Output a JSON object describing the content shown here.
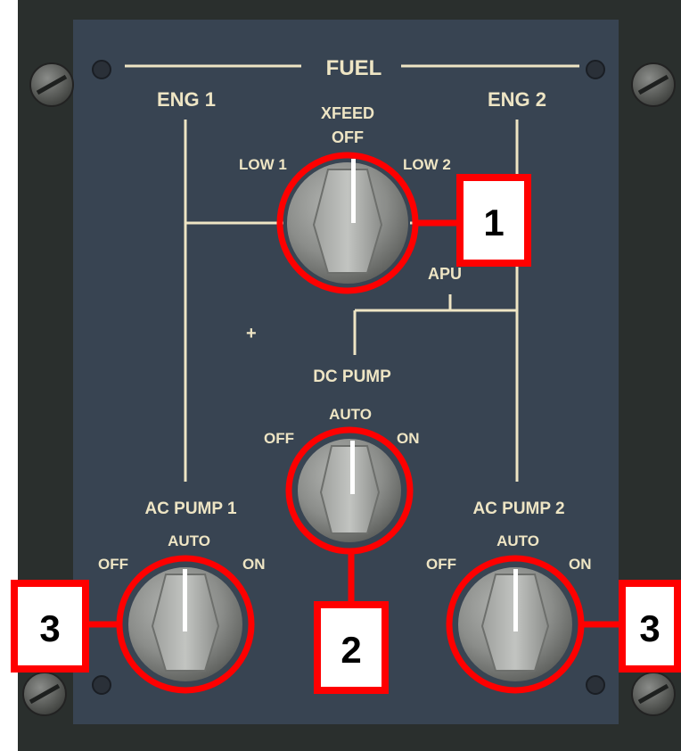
{
  "panel": {
    "title": "FUEL",
    "eng1": "ENG 1",
    "eng2": "ENG 2",
    "apu": "APU",
    "marker": "+"
  },
  "xfeed": {
    "label": "XFEED",
    "pos_top": "OFF",
    "pos_left": "LOW 1",
    "pos_right": "LOW 2",
    "selected": "OFF"
  },
  "dc_pump": {
    "label": "DC PUMP",
    "pos_left": "OFF",
    "pos_top": "AUTO",
    "pos_right": "ON",
    "selected": "AUTO"
  },
  "ac_pump_1": {
    "label": "AC PUMP 1",
    "pos_left": "OFF",
    "pos_top": "AUTO",
    "pos_right": "ON",
    "selected": "AUTO"
  },
  "ac_pump_2": {
    "label": "AC PUMP 2",
    "pos_left": "OFF",
    "pos_top": "AUTO",
    "pos_right": "ON",
    "selected": "AUTO"
  },
  "callouts": {
    "c1": "1",
    "c2": "2",
    "c3_left": "3",
    "c3_right": "3"
  },
  "colors": {
    "panel": "#384452",
    "frame": "#2a2f2d",
    "legend": "#eee5c4",
    "highlight": "#ff0000",
    "knob": "#8b8d8a"
  }
}
